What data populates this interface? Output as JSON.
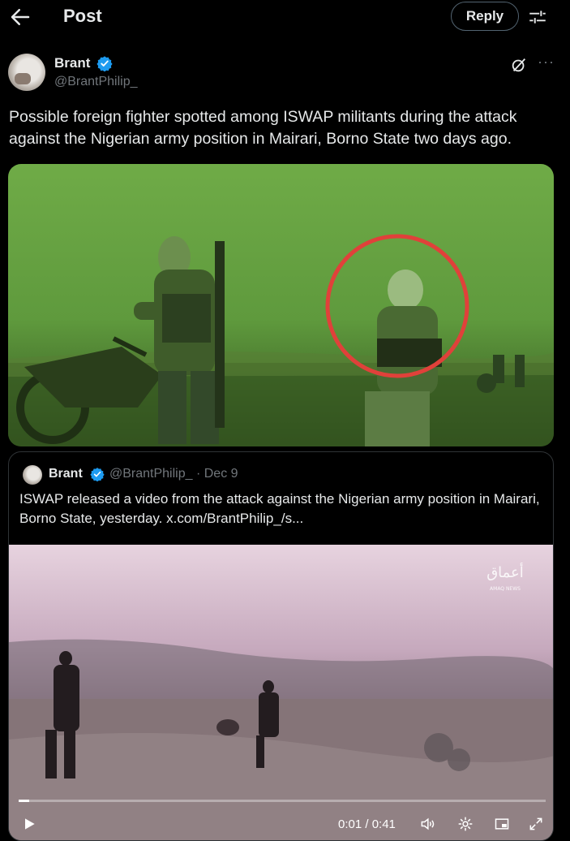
{
  "header": {
    "title": "Post",
    "reply_label": "Reply"
  },
  "icons": {
    "back": "arrow-left-icon",
    "tune": "sliders-icon",
    "grok": "grok-icon",
    "more": "more-icon",
    "verified": "verified-badge-icon",
    "play": "play-icon",
    "volume": "volume-icon",
    "settings": "gear-icon",
    "pip": "picture-in-picture-icon",
    "fullscreen": "fullscreen-icon"
  },
  "colors": {
    "accent": "#1d9bf0",
    "background": "#000000",
    "text": "#e7e9ea",
    "muted": "#71767b",
    "circle": "#e0413a"
  },
  "post": {
    "author_name": "Brant",
    "handle": "@BrantPhilip_",
    "more": "···",
    "text": "Possible foreign fighter spotted among ISWAP militants during the attack against the Nigerian army position in Mairari, Borno State two days ago."
  },
  "quote": {
    "author_name": "Brant",
    "handle_date": "@BrantPhilip_ · Dec 9",
    "text": "ISWAP released a video from the attack against the Nigerian army position in Mairari, Borno State, yesterday.  x.com/BrantPhilip_/s...",
    "watermark": "أعماق",
    "watermark_sub": "AMAQ NEWS",
    "video": {
      "time": "0:01 / 0:41",
      "progress": 0.02
    }
  }
}
